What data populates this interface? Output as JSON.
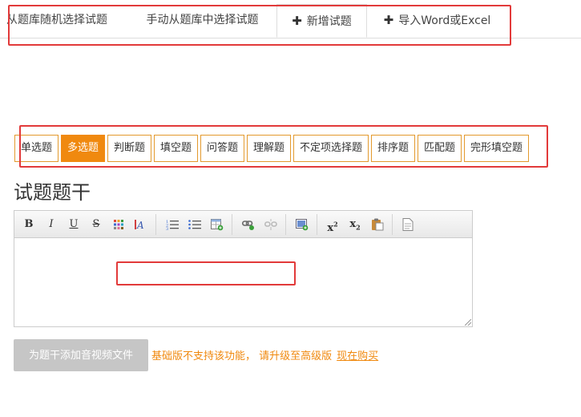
{
  "tabs": [
    {
      "label": "从题库随机选择试题",
      "icon": "",
      "active": false
    },
    {
      "label": "手动从题库中选择试题",
      "icon": "",
      "active": false
    },
    {
      "label": "新增试题",
      "icon": "plus-icon",
      "active": true
    },
    {
      "label": "导入Word或Excel",
      "icon": "plus-icon",
      "active": false
    }
  ],
  "question_types": [
    {
      "label": "单选题",
      "active": false
    },
    {
      "label": "多选题",
      "active": true
    },
    {
      "label": "判断题",
      "active": false
    },
    {
      "label": "填空题",
      "active": false
    },
    {
      "label": "问答题",
      "active": false
    },
    {
      "label": "理解题",
      "active": false
    },
    {
      "label": "不定项选择题",
      "active": false
    },
    {
      "label": "排序题",
      "active": false
    },
    {
      "label": "匹配题",
      "active": false
    },
    {
      "label": "完形填空题",
      "active": false
    }
  ],
  "stem_heading": "试题题干",
  "editor": {
    "toolbar": {
      "bold": "B",
      "italic": "I",
      "underline": "U",
      "strike": "S"
    },
    "content": ""
  },
  "media": {
    "button_label": "为题干添加音视频文件",
    "notice": "基础版不支持该功能， 请升级至高级版",
    "buy_link": "现在购买"
  },
  "colors": {
    "accent": "#f0890f",
    "annotation": "#e23a3a",
    "disabled": "#c6c6c6"
  }
}
